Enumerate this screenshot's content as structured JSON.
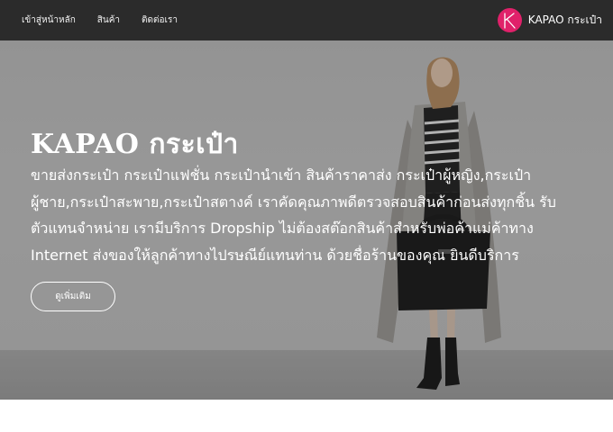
{
  "nav": {
    "links": [
      {
        "label": "เข้าสู่หน้าหลัก"
      },
      {
        "label": "สินค้า"
      },
      {
        "label": "ติดต่อเรา"
      }
    ],
    "brand": {
      "logo_letter": "K",
      "name": "KAPAO กระเป๋า",
      "logo_color": "#e0216a"
    }
  },
  "hero": {
    "title": "KAPAO กระเป๋า",
    "description": "ขายส่งกระเป๋า กระเป๋าแฟชั่น กระเป๋านำเข้า สินค้าราคาส่ง กระเป๋าผู้หญิง,กระเป๋าผู้ชาย,กระเป๋าสะพาย,กระเป๋าสตางค์ เราคัดคุณภาพดีตรวจสอบสินค้าก่อนส่งทุกชิ้น รับตัวแทนจำหน่าย เรามีบริการ Dropship ไม่ต้องสต๊อกสินค้าสำหรับพ่อค้าแม่ค้าทาง Internet ส่งของให้ลูกค้าทางไปรษณีย์แทนท่าน ด้วยชื่อร้านของคุณ ยินดีบริการ",
    "button_label": "ดูเพิ่มเติม"
  },
  "colors": {
    "navbar": "#2b2b2b",
    "accent": "#e0216a",
    "hero_text": "#ffffff"
  }
}
